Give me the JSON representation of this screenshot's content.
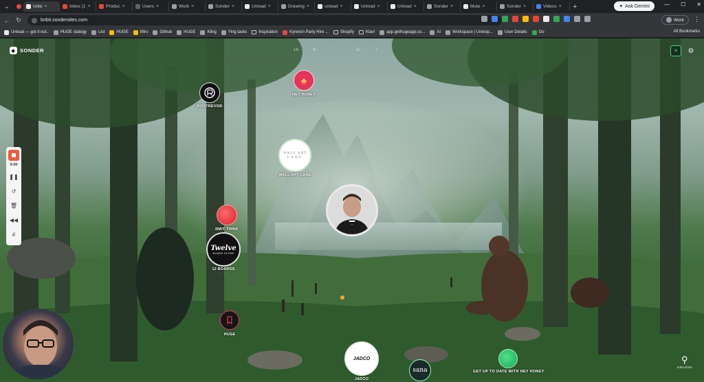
{
  "browser": {
    "tabs": [
      {
        "label": "Unlo",
        "active": true,
        "color": "#e8eaed"
      },
      {
        "label": "Inbox (1",
        "active": false,
        "color": "#ea4335"
      },
      {
        "label": "Produc",
        "active": false,
        "color": "#e8453c"
      },
      {
        "label": "Users",
        "active": false,
        "color": "#5f6368"
      },
      {
        "label": "Work",
        "active": false,
        "color": "#9aa0a6"
      },
      {
        "label": "Sonder",
        "active": false,
        "color": "#9aa0a6"
      },
      {
        "label": "Unload",
        "active": false,
        "color": "#e8eaed"
      },
      {
        "label": "Drawing",
        "active": false,
        "color": "#9aa0a6"
      },
      {
        "label": "unload",
        "active": false,
        "color": "#e8eaed"
      },
      {
        "label": "Unload",
        "active": false,
        "color": "#e8eaed"
      },
      {
        "label": "Unload",
        "active": false,
        "color": "#e8eaed"
      },
      {
        "label": "Sonder",
        "active": false,
        "color": "#9aa0a6"
      },
      {
        "label": "Mute",
        "active": false,
        "color": "#e8eaed"
      },
      {
        "label": "Sonder",
        "active": false,
        "color": "#9aa0a6"
      },
      {
        "label": "Videos",
        "active": false,
        "color": "#4285f4"
      }
    ],
    "ask_gemini": "Ask Gemini",
    "url": "lorbit.sondersites.com",
    "profile_label": "Work",
    "bookmarks": [
      {
        "label": "Unload — got it out..",
        "color": "#e8eaed"
      },
      {
        "label": "HUGE stategy",
        "color": "#9aa0a6"
      },
      {
        "label": "List",
        "color": "#9aa0a6"
      },
      {
        "label": "HUGE",
        "color": "#fbbc04"
      },
      {
        "label": "Miro",
        "color": "#fbbc04"
      },
      {
        "label": "Github",
        "color": "#9aa0a6"
      },
      {
        "label": "HUGE",
        "color": "#9aa0a6"
      },
      {
        "label": "Kling",
        "color": "#9aa0a6"
      },
      {
        "label": "Ying tasks",
        "color": "#9aa0a6"
      },
      {
        "label": "Inspiration",
        "color": "folder"
      },
      {
        "label": "Kyneton Party Hire ...",
        "color": "#e8453c"
      },
      {
        "label": "Shopify",
        "color": "folder"
      },
      {
        "label": "Klavi",
        "color": "folder"
      },
      {
        "label": "app.gethugeapp.co...",
        "color": "#9aa0a6"
      },
      {
        "label": "AI",
        "color": "#9aa0a6"
      },
      {
        "label": "Workspace | Unloop...",
        "color": "#9aa0a6"
      },
      {
        "label": "User Details",
        "color": "#9aa0a6"
      },
      {
        "label": "Go",
        "color": "#34a853"
      }
    ],
    "all_bookmarks": "All Bookmarks"
  },
  "app": {
    "brand": "SONDER",
    "stats_text": "16 · · · · 8 · · · · · · · · · · · · 32 · · · · 7",
    "recorder": {
      "time": "0:00"
    },
    "nodes": [
      {
        "id": "rostrevor",
        "label": "ROSTREVOR",
        "sub": "··· ···"
      },
      {
        "id": "hey-honey",
        "label": "HEY HONEY",
        "sub": ""
      },
      {
        "id": "wall-art-lane",
        "label": "WALL ART LANE",
        "sub": "··· ···",
        "logo_top": "WALL ART",
        "logo_bottom": "LANE"
      },
      {
        "id": "rmit-think",
        "label": "RMIT THINK",
        "sub": ""
      },
      {
        "id": "12-boards",
        "label": "12 BOARDS",
        "sub": "··· ···",
        "logo_top": "Twelve",
        "logo_bottom": "BOARD STORE"
      },
      {
        "id": "huge",
        "label": "HUGE",
        "sub": ""
      },
      {
        "id": "jadco",
        "label": "JADCO",
        "sub": "",
        "logo_text": "JADCO"
      },
      {
        "id": "sana",
        "label": "",
        "sub": "",
        "logo_text": "sana"
      }
    ],
    "cta": "GET UP TO DATE WITH HEY HONEY",
    "footer_logo": "UNLOAD"
  }
}
